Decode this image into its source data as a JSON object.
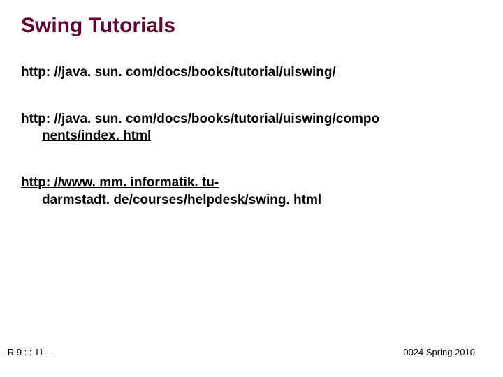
{
  "title": "Swing Tutorials",
  "links": {
    "link1_line1": "http: //java. sun. com/docs/books/tutorial/uiswing/",
    "link2_line1": "http: //java. sun. com/docs/books/tutorial/uiswing/compo",
    "link2_line2": "nents/index. html",
    "link3_line1": "http: //www. mm. informatik. tu-",
    "link3_line2": "darmstadt. de/courses/helpdesk/swing. html"
  },
  "footer": {
    "left": "– R 9 : :  11 –",
    "right": "0024 Spring 2010"
  }
}
